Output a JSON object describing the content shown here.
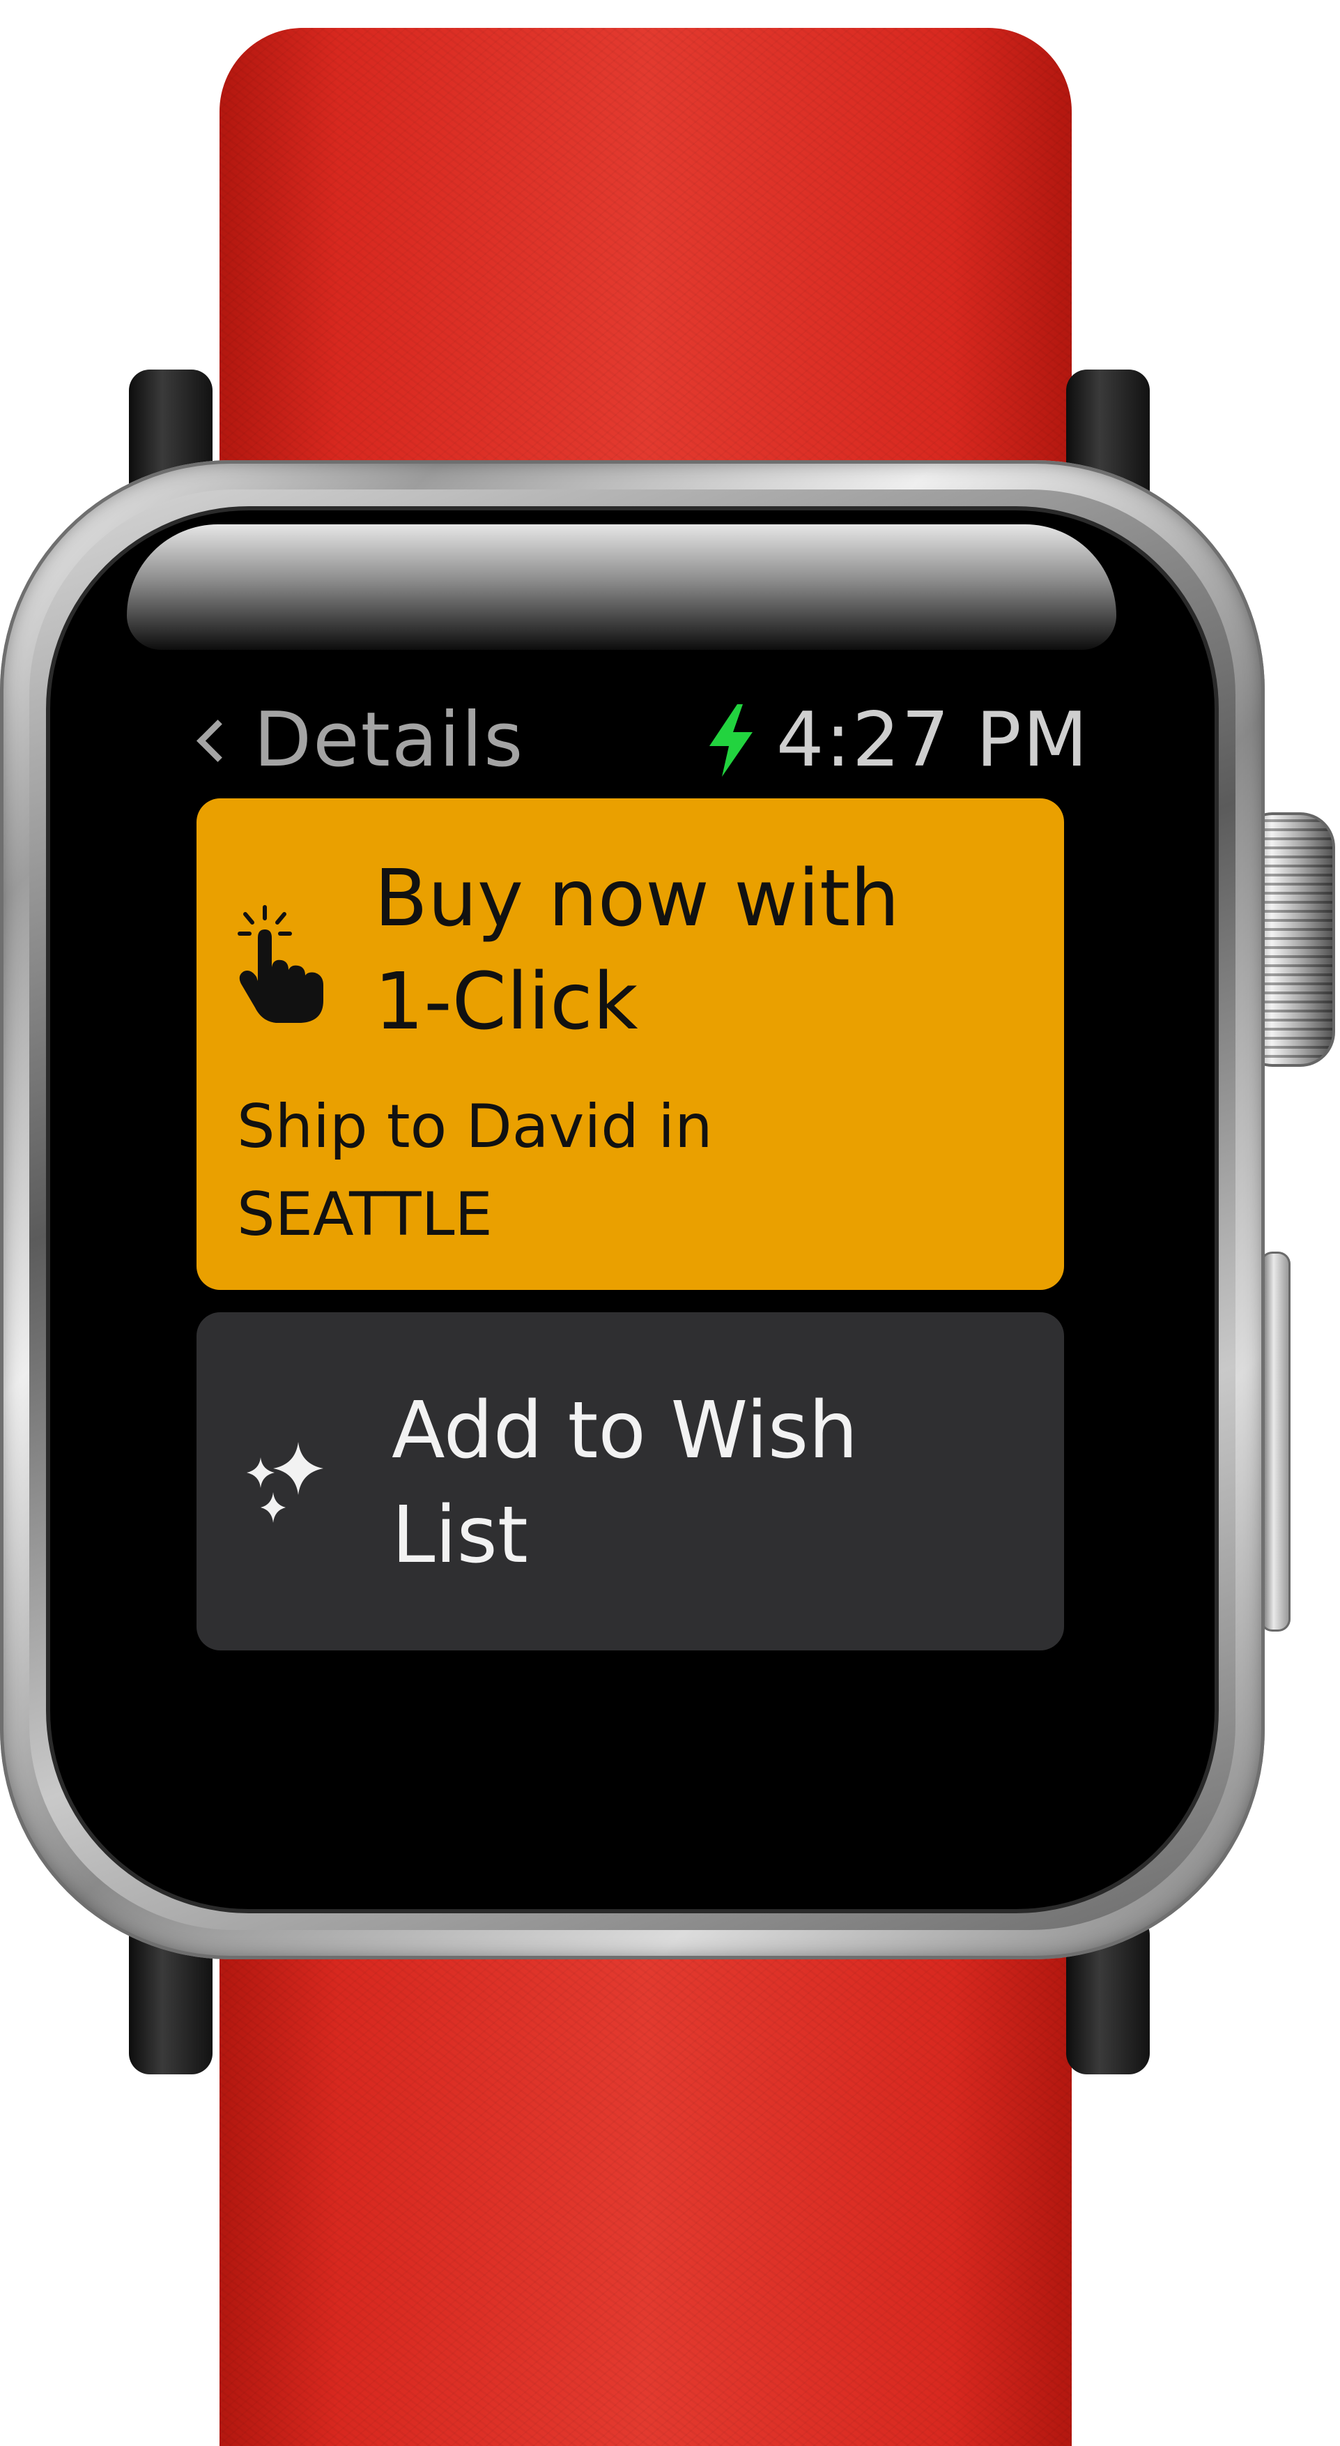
{
  "nav": {
    "back_label": "Details",
    "time": "4:27 PM",
    "charging_icon": "lightning-bolt-icon",
    "charging_color": "#22d33f"
  },
  "buy_card": {
    "icon": "tap-hand-icon",
    "title_line1": "Buy now with",
    "title_line2": "1-Click",
    "ship_line1": "Ship to David in",
    "ship_line2": "SEATTLE",
    "background_color": "#eaa000"
  },
  "wish_card": {
    "icon": "sparkles-icon",
    "title_line1": "Add to Wish",
    "title_line2": "List",
    "background_color": "#2f2f31"
  },
  "watch": {
    "strap_color": "#d8281f",
    "screen_color": "#000000"
  }
}
